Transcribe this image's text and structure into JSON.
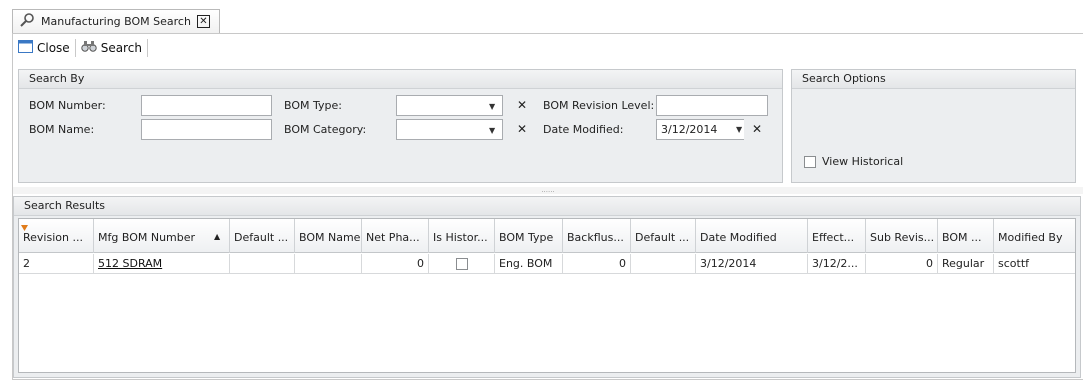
{
  "tab": {
    "title": "Manufacturing BOM Search",
    "icon": "magnifier-icon"
  },
  "toolbar": {
    "close_label": "Close",
    "search_label": "Search"
  },
  "search_by": {
    "header": "Search By",
    "bom_number_label": "BOM Number:",
    "bom_number_value": "",
    "bom_name_label": "BOM Name:",
    "bom_name_value": "",
    "bom_type_label": "BOM Type:",
    "bom_type_value": "",
    "bom_category_label": "BOM Category:",
    "bom_category_value": "",
    "bom_revision_level_label": "BOM Revision Level:",
    "bom_revision_level_value": "",
    "date_modified_label": "Date Modified:",
    "date_modified_value": "3/12/2014"
  },
  "search_options": {
    "header": "Search Options",
    "view_historical_label": "View Historical",
    "view_historical_checked": false
  },
  "splitter_grip": "......",
  "results": {
    "header": "Search Results",
    "columns": [
      "Revision ...",
      "Mfg BOM Number",
      "Default ...",
      "BOM Name",
      "Net Pha...",
      "Is Histor...",
      "BOM Type",
      "Backflus...",
      "Default ...",
      "Date Modified",
      "Effect...",
      "Sub Revis...",
      "BOM ...",
      "Modified By"
    ],
    "sorted_column_arrow": "▲",
    "rows": [
      [
        "2",
        "512 SDRAM",
        "",
        "",
        "0",
        "",
        "Eng. BOM",
        "0",
        "",
        "3/12/2014",
        "3/12/2...",
        "0",
        "Regular",
        "scottf"
      ]
    ]
  },
  "colors": {
    "panel_bg": "#eceef0",
    "border": "#c6c9cc",
    "filter_marker": "#e07b1a"
  }
}
